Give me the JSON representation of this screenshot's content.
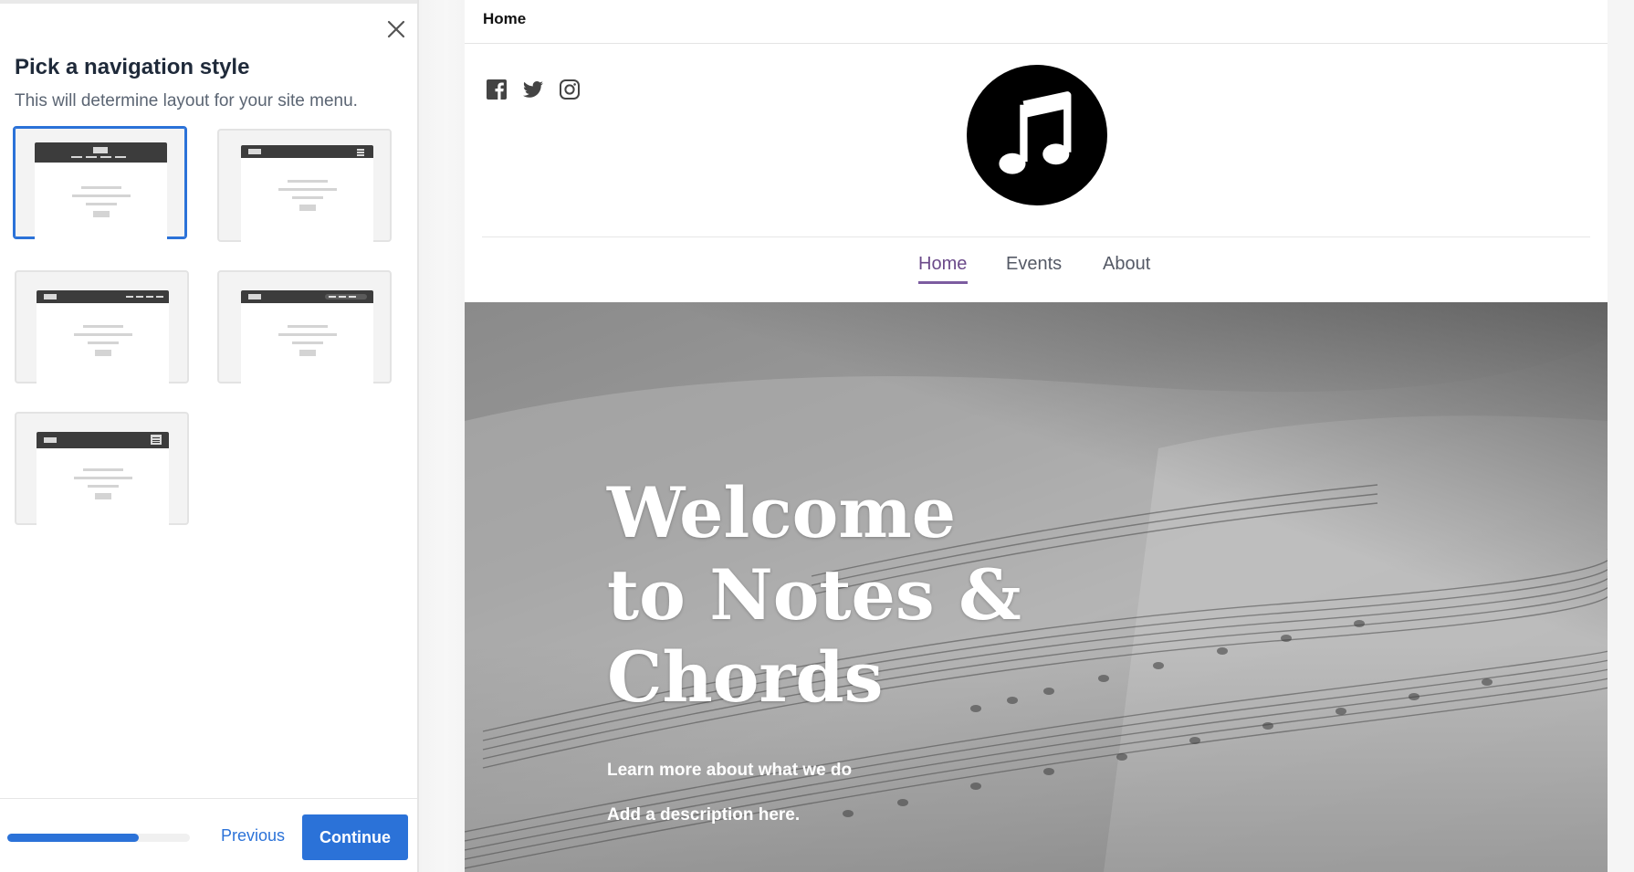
{
  "panel": {
    "title": "Pick a navigation style",
    "subtitle": "This will determine layout for your site menu.",
    "styles": [
      {
        "id": "centered-logo-menu",
        "selected": true
      },
      {
        "id": "left-logo-hamburger",
        "selected": false
      },
      {
        "id": "left-logo-right-menu",
        "selected": false
      },
      {
        "id": "left-logo-right-menu-pill",
        "selected": false
      },
      {
        "id": "left-logo-hamburger-box",
        "selected": false
      }
    ],
    "footer": {
      "progress_fraction": 0.72,
      "previous_label": "Previous",
      "continue_label": "Continue"
    }
  },
  "preview": {
    "page_tab": "Home",
    "social_icons": [
      "facebook-icon",
      "twitter-icon",
      "instagram-icon"
    ],
    "logo_icon": "music-note-icon",
    "nav": [
      {
        "label": "Home",
        "active": true
      },
      {
        "label": "Events",
        "active": false
      },
      {
        "label": "About",
        "active": false
      }
    ],
    "hero": {
      "title": "Welcome to Notes & Chords",
      "link": "Learn more about what we do",
      "description": "Add a description here."
    }
  },
  "colors": {
    "accent": "#2b72d8",
    "nav_active": "#6b4a8a",
    "title_text": "#1f2a3a"
  }
}
